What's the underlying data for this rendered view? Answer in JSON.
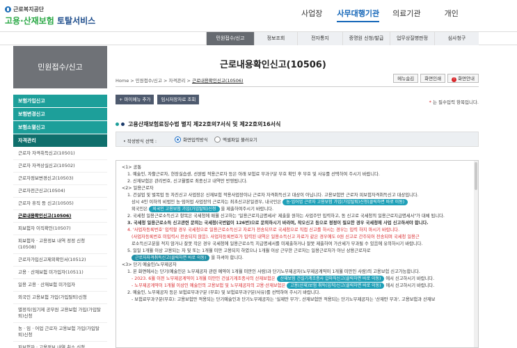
{
  "logo": {
    "top": "근로복지공단",
    "bottom_a": "고용·산재보험",
    "bottom_b": " 토탈서비스"
  },
  "gnb": [
    "사업장",
    "사무대행기관",
    "의료기관",
    "개인"
  ],
  "subtabs": [
    "민원접수/신고",
    "정보조회",
    "전자통지",
    "증명원 신청/발급",
    "업무상질병판정",
    "심사청구"
  ],
  "sidebar": {
    "title": "민원접수/신고",
    "mains": [
      "보험가입신고",
      "보험변경신고",
      "보험소멸신고",
      "자격관리"
    ],
    "subs": [
      "근로자 자격취득신고(10501)",
      "근로자 자격상실신고(10502)",
      "근로자정보변경신고(10503)",
      "근로자전근신고(10504)",
      "근로자 휴직 등 신고(10505)",
      "근로내용확인신고(10506)",
      "피보험자 이직확인(10507)",
      "피보험자 · 고용정보 내역 정정 신청(10508)",
      "근로자가입신고제외확인서(10512)",
      "고용 · 산재보험 미가입자(10511)",
      "일용 고용 · 산재보험 미가입자",
      "외국인 고용보험 가입(가입탈퇴)신청",
      "별정직(임기제 공무원 고용보험 가입(가입탈퇴)신청",
      "농 · 임 · 어업 근로자 고용보험 가입(가입탈퇴)신청",
      "피보험자 · 고용정보 내역 취소 신청"
    ]
  },
  "page": {
    "title": "근로내용확인신고(10506)",
    "breadcrumb": [
      "Home",
      "민원접수/신고",
      "자격관리",
      "근로내용확인신고(10506)"
    ],
    "top_buttons": [
      "메뉴숨김",
      "화면인쇄",
      "화면안내"
    ],
    "action_buttons": [
      "+ 마이메뉴 추가",
      "임시저장자료 조회"
    ],
    "required_note": "는 필수입력 항목입니다.",
    "required_star": "*",
    "section_title": "고용산재보험료징수법 별지 제22호의7서식 및 제22호의16서식",
    "method_label": "작성방식 선택 :",
    "method_options": [
      "화면입력방식",
      "엑셀파일 불러오기"
    ]
  },
  "notice": {
    "h1": "<1> 공통",
    "c1": "1. 예술인, 자활근로자, 현장실습생, 선원법 적용근로자 등은 아래 보험료 부과구분 부호 확인 후 부호 및 사유를 선택하여 주시기 바랍니다.",
    "c2": "2. 신재보험은 관리번호, 신고월별로 최종신고 내역만 반영됩니다.",
    "h2": "<2> 일용근로자",
    "d1": "1. 건설업 및 벌목업 등 자진신고 사업장은 신재보험 적용사업장이나 근로자 자격취득신고 대상이 아닙니다. 고용보험만 근로자 피보험자격취득신고 대상입니다.",
    "d1b": "상시 4인 이하의 비법인 농·임어업 사업장의 근로자는 최초신고본일경우, 내국인은",
    "d1pill": "농·임어업 근로자 고용보험 가입(가입탈퇴)신청(클릭하면 바로 이동)",
    "d1c": "외국인은",
    "d1pill2": "외국인 고용보험 가입(가입탈퇴)신청",
    "d1d": "을 제출하여주시기 바랍니다.",
    "d2": "2. 국세청 일용근로소득신고 항목은 국세청에 매월 신고하는 '일용근로지급명세서' 제출을 원하는 사업주만 입력하고, 동 신고로 국세청의 일용근로지급명세서\"가 대체 됩니다.",
    "d3": "3. 국세청 일용근로소득 신고관련 문의는 국세청(국번없이 126번)으로 문의하시기 바라며, 작오신고 등으로 정정이 필요한 경우 국세청에 사업 신고하셔야 합니다.",
    "d4a": "4. '사업자등록번호' 입력할 경우 국세청으로 일용근로소득신고 자료가 전송되므로 국세청으로 직접 신고를 하시는 경우는 입력 하지 마시기 바랍니다.",
    "d4b": "(사업자등록번호 미입력시 전송되지 않음). 사업자등록번호가 입력된 내역은 일용소득신고 자료가 같은 경우에도 0원 신고로 간주되어 전송되며 국세청 일용근",
    "d4c": "로소득신고분을 적지 않거나 잘못 작은 경우 국세청에 일용근로소득 지급명세서를 미제출하거나 잘못 제출하여 가산세가 부과될 수 있음에 유의하시기 바랍니다.",
    "d5a": "5. 일일 1개월 이상 고용되는 자 및 또는 1개월 미만 고용되지 하였으나 1개월 이상 근무한 근로자는 일용근로자가 아닌 상용근로자로",
    "d5pill": "근로자자격취득신고(클릭하면 바로 이동)",
    "d5b": "을 하셔야 합니다.",
    "h3": "<3> 단기 예술인/노무제공자",
    "e1": "1. 본 화면에서는 단기(예술인은 노무제공자 관련 예약이 1개월 미만인 사람)과 단기노무제공자(노무제공계약이 1개월 미만인 사람)의 고용보험 신고가능합니다.",
    "e2a": "- 2023. 6월 이전 노무제공계약이 1개월 미만인 건설기계조종사의 산재보험은",
    "e2pill": "산재보험 건설기계조종사 압마직신고(클릭하면 바로 이동)",
    "e2b": "에서 신고하시기 바랍니다.",
    "e3a": "- 노무제공계약이 1개월 이상인 예술인의 고용보험 및 노무제공자의 고용·산재보험은",
    "e3pill": "고용(산재)보험 취득(입직)신고(클릭하면 바로 이동)",
    "e3b": "에서 신고하시기 바랍니다.",
    "e4": "2. 예술인, 노무제공자 등은 보험료부과구분 (부호) 및 보험료부과구분(사유)를 선택하여 주시기 바랍니다.",
    "e5": "- 보험료부과구분(부호): 고용보험만 적용되는 단기예술인과 단기노무제공자는 '실제만 부가', 산재보험만 적용되는 단기노무제공자는 '산재만 부과', 고용보험과 산재보"
  },
  "colors": {
    "accent": "#1d9f9a",
    "brand": "#1466b8",
    "pill": "#1fa0b8",
    "alert": "#d9262a"
  }
}
